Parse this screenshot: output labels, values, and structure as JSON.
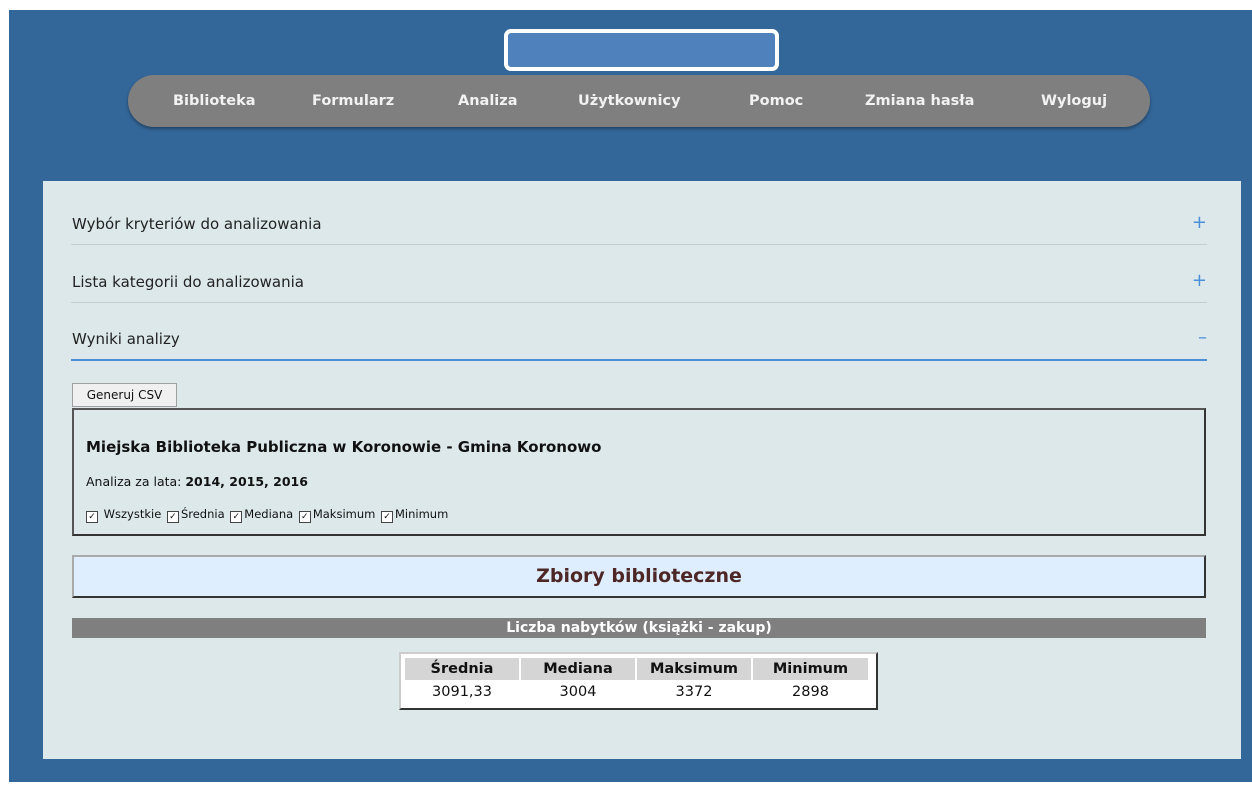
{
  "nav": {
    "items": [
      {
        "label": "Biblioteka"
      },
      {
        "label": "Formularz"
      },
      {
        "label": "Analiza"
      },
      {
        "label": "Użytkownicy"
      },
      {
        "label": "Pomoc"
      },
      {
        "label": "Zmiana hasła"
      },
      {
        "label": "Wyloguj"
      }
    ]
  },
  "accordion": {
    "sections": [
      {
        "title": "Wybór kryteriów do analizowania",
        "sign": "+"
      },
      {
        "title": "Lista kategorii do analizowania",
        "sign": "+"
      },
      {
        "title": "Wyniki analizy",
        "sign": "–"
      }
    ]
  },
  "results": {
    "csv_button": "Generuj CSV",
    "library_name": "Miejska Biblioteka Publiczna w Koronowie - Gmina Koronowo",
    "years_label": "Analiza za lata:",
    "years_value": "2014, 2015, 2016",
    "checkboxes": [
      {
        "label": "Wszystkie",
        "checked": true
      },
      {
        "label": "Średnia",
        "checked": true
      },
      {
        "label": "Mediana",
        "checked": true
      },
      {
        "label": "Maksimum",
        "checked": true
      },
      {
        "label": "Minimum",
        "checked": true
      }
    ],
    "check_mark": "✓",
    "section_title": "Zbiory biblioteczne",
    "table_title": "Liczba nabytków (książki - zakup)",
    "table": {
      "headers": [
        "Średnia",
        "Mediana",
        "Maksimum",
        "Minimum"
      ],
      "values": [
        "3091,33",
        "3004",
        "3372",
        "2898"
      ]
    }
  },
  "colors": {
    "background": "#336699",
    "nav_bar": "#7f7f7f",
    "panel": "#dde8eb",
    "accent": "#4a8fd8",
    "banner": "#deeeff",
    "banner_text": "#4d2626"
  }
}
